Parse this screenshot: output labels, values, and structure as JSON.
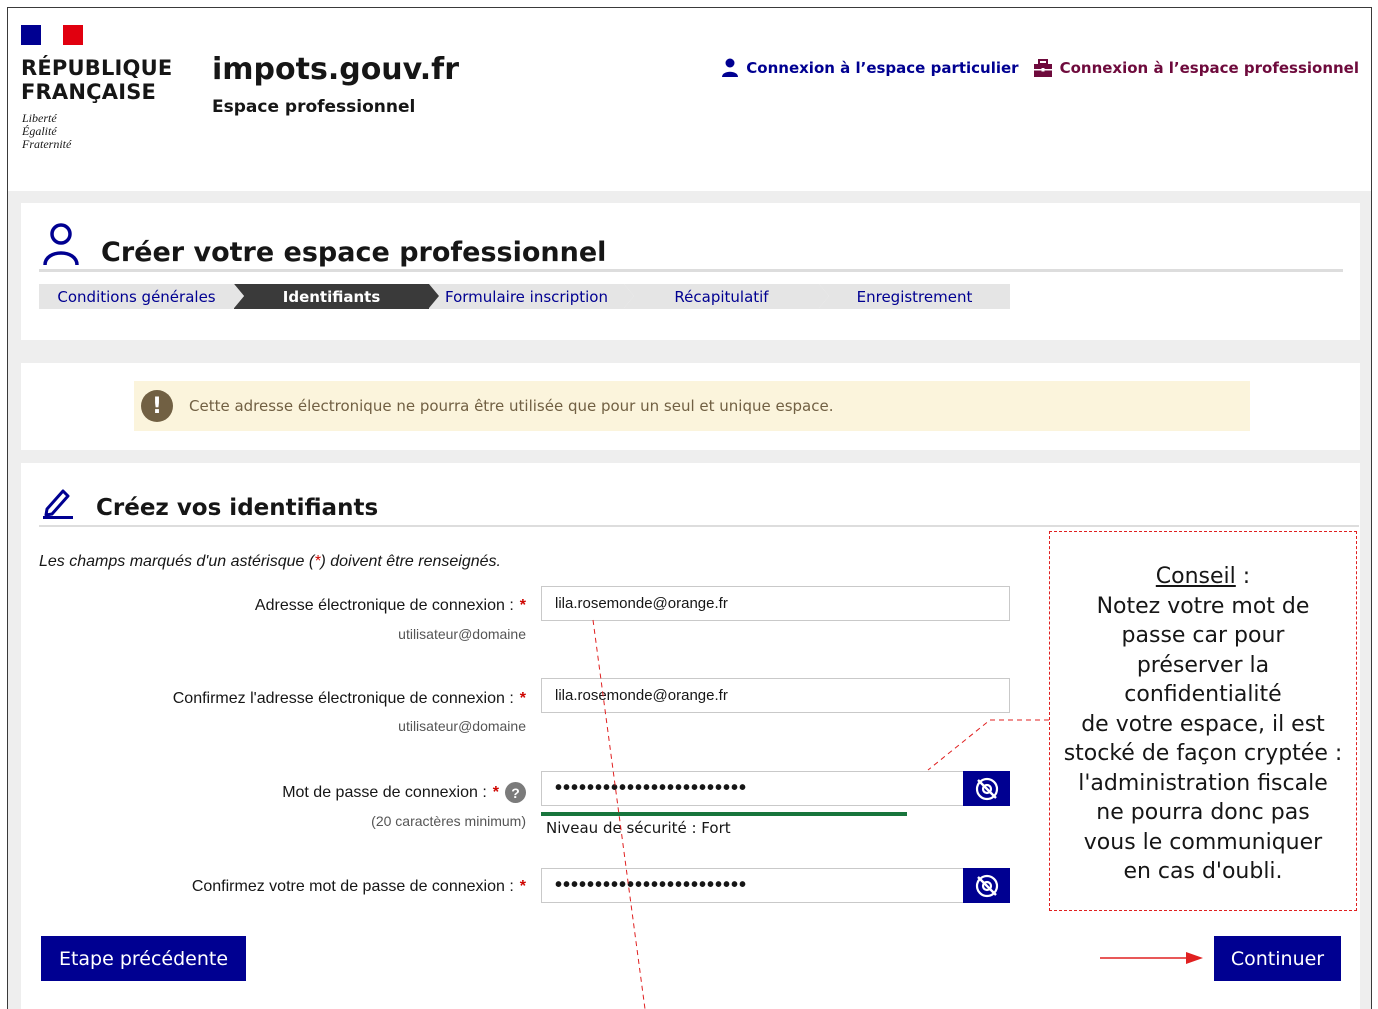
{
  "header": {
    "republique_line1": "RÉPUBLIQUE",
    "republique_line2": "FRANÇAISE",
    "motto_1": "Liberté",
    "motto_2": "Égalité",
    "motto_3": "Fraternité",
    "site_title": "impots.gouv.fr",
    "site_subtitle": "Espace professionnel",
    "link_particulier": "Connexion à l’espace particulier",
    "link_professionnel": "Connexion à l’espace professionnel",
    "colors": {
      "blue": "#000091",
      "red": "#e1000f",
      "pro": "#6e0a3c"
    }
  },
  "wizard": {
    "title": "Créer votre espace professionnel",
    "steps": [
      {
        "label": "Conditions générales",
        "active": false
      },
      {
        "label": "Identifiants",
        "active": true
      },
      {
        "label": "Formulaire inscription",
        "active": false
      },
      {
        "label": "Récapitulatif",
        "active": false
      },
      {
        "label": "Enregistrement",
        "active": false
      }
    ]
  },
  "alert": {
    "icon": "exclamation-icon",
    "text": "Cette adresse électronique ne pourra être utilisée que pour un seul et unique espace."
  },
  "form": {
    "title": "Créez vos identifiants",
    "required_note_before": "Les champs marqués d'un astérisque (",
    "required_note_star": "*",
    "required_note_after": ") doivent être renseignés.",
    "email_label": "Adresse électronique de connexion :",
    "email_hint": "utilisateur@domaine",
    "email_value": "lila.rosemonde@orange.fr",
    "email_confirm_label": "Confirmez l'adresse électronique de connexion :",
    "email_confirm_hint": "utilisateur@domaine",
    "email_confirm_value": "lila.rosemonde@orange.fr",
    "password_label": "Mot de passe de connexion :",
    "password_hint": "(20 caractères minimum)",
    "password_value": "••••••••••••••••••••••••",
    "password_strength": "Niveau de sécurité : Fort",
    "password_strength_level": 0.75,
    "password_confirm_label": "Confirmez votre mot de passe de connexion :",
    "password_confirm_value": "••••••••••••••••••••••••",
    "required_star": "*",
    "help_glyph": "?"
  },
  "buttons": {
    "previous": "Etape précédente",
    "next": "Continuer"
  },
  "advice": {
    "title": "Conseil",
    "colon": " :",
    "lines": [
      "Notez votre mot de",
      "passe car pour",
      "préserver la",
      "confidentialité",
      "de votre espace, il est",
      "stocké de façon cryptée :",
      "l'administration fiscale",
      "ne pourra donc pas",
      "vous le communiquer",
      "en cas d'oubli."
    ]
  }
}
